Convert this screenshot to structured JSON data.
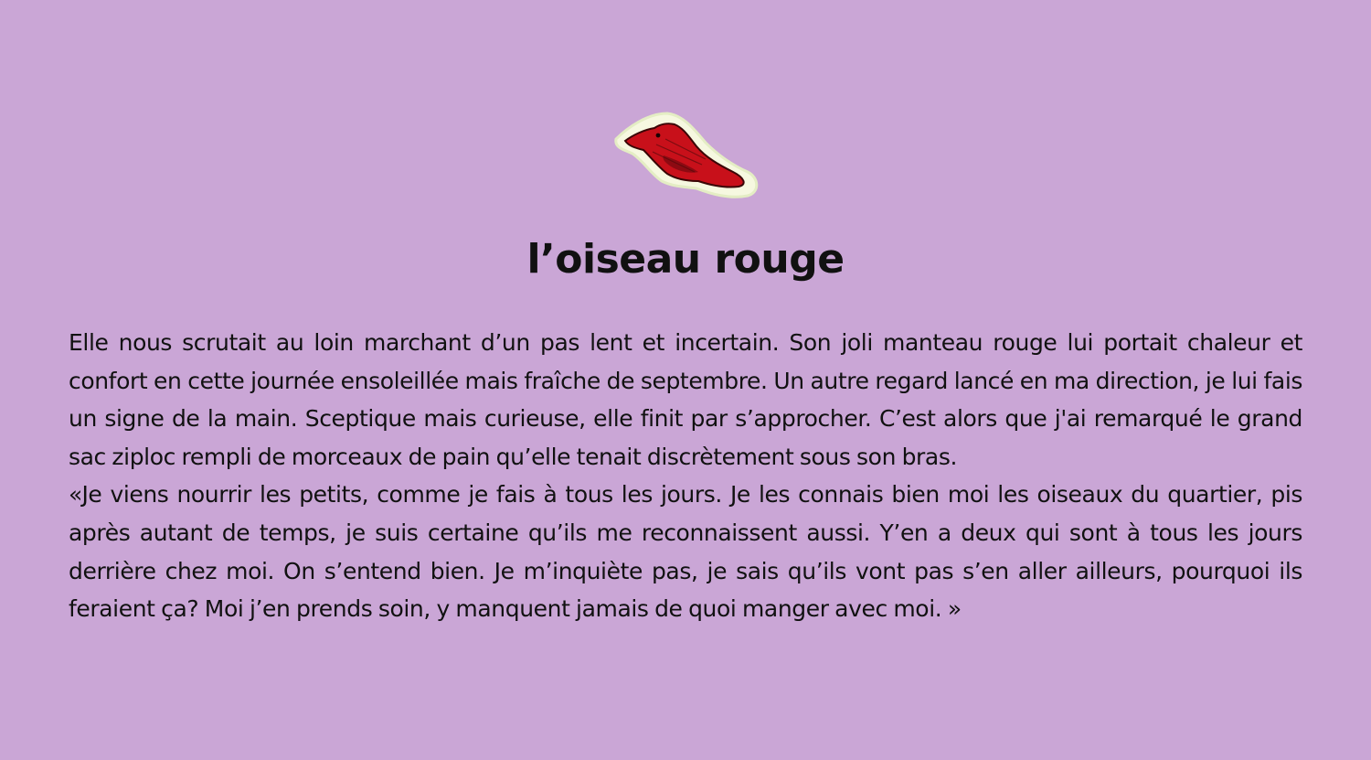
{
  "illustration": {
    "icon": "red-bird-icon",
    "colors": {
      "body": "#c8101a",
      "outline": "#3a0606",
      "halo": "#f6f8e0"
    }
  },
  "title": "l’oiseau rouge",
  "paragraphs": [
    "Elle nous scrutait au loin marchant d’un pas lent et incertain. Son joli manteau rouge lui portait chaleur et confort en cette journée ensoleillée mais fraîche de septembre. Un autre regard lancé en ma direction, je lui fais un signe de la main. Sceptique mais curieuse, elle finit par s’approcher. C’est alors que j'ai remarqué le grand sac ziploc rempli de morceaux de pain qu’elle tenait discrètement sous son bras.",
    "«Je viens nourrir les petits, comme je fais à tous les jours. Je les connais bien moi les oiseaux du quartier, pis après autant de temps, je suis certaine qu’ils me reconnaissent aussi. Y’en a deux qui sont à tous les jours derrière chez moi. On s’entend bien. Je m’inquiète pas, je sais qu’ils vont pas s’en aller ailleurs, pourquoi ils feraient ça? Moi j’en prends soin, y manquent jamais de quoi manger avec moi. »"
  ],
  "background_color": "#caa6d6"
}
